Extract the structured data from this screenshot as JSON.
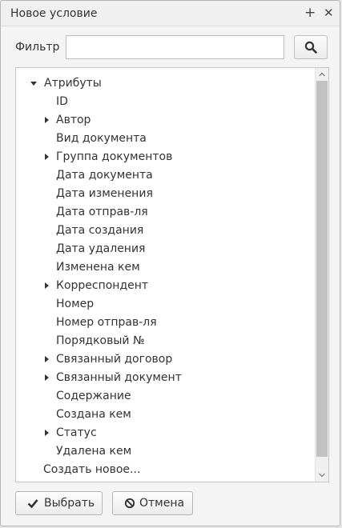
{
  "dialog": {
    "title": "Новое условие",
    "maximize_icon": "plus-icon",
    "close_icon": "close-icon"
  },
  "filter": {
    "label": "Фильтр",
    "value": "",
    "placeholder": "",
    "search_icon": "search-icon"
  },
  "tree": {
    "root": {
      "label": "Атрибуты",
      "expanded": true
    },
    "items": [
      {
        "label": "ID",
        "expandable": false
      },
      {
        "label": "Автор",
        "expandable": true
      },
      {
        "label": "Вид документа",
        "expandable": false
      },
      {
        "label": "Группа документов",
        "expandable": true
      },
      {
        "label": "Дата документа",
        "expandable": false
      },
      {
        "label": "Дата изменения",
        "expandable": false
      },
      {
        "label": "Дата отправ-ля",
        "expandable": false
      },
      {
        "label": "Дата создания",
        "expandable": false
      },
      {
        "label": "Дата удаления",
        "expandable": false
      },
      {
        "label": "Изменена кем",
        "expandable": false
      },
      {
        "label": "Корреспондент",
        "expandable": true
      },
      {
        "label": "Номер",
        "expandable": false
      },
      {
        "label": "Номер отправ-ля",
        "expandable": false
      },
      {
        "label": "Порядковый №",
        "expandable": false
      },
      {
        "label": "Связанный договор",
        "expandable": true
      },
      {
        "label": "Связанный документ",
        "expandable": true
      },
      {
        "label": "Содержание",
        "expandable": false
      },
      {
        "label": "Создана кем",
        "expandable": false
      },
      {
        "label": "Статус",
        "expandable": true
      },
      {
        "label": "Удалена кем",
        "expandable": false
      }
    ],
    "create_new": "Создать новое..."
  },
  "buttons": {
    "select": {
      "label": "Выбрать",
      "icon": "check-icon"
    },
    "cancel": {
      "label": "Отмена",
      "icon": "ban-icon"
    }
  },
  "colors": {
    "dialog_bg": "#f4f4f4",
    "tree_bg": "#ffffff",
    "border": "#c5c5c5",
    "scroll_thumb": "#c2c2c2"
  }
}
